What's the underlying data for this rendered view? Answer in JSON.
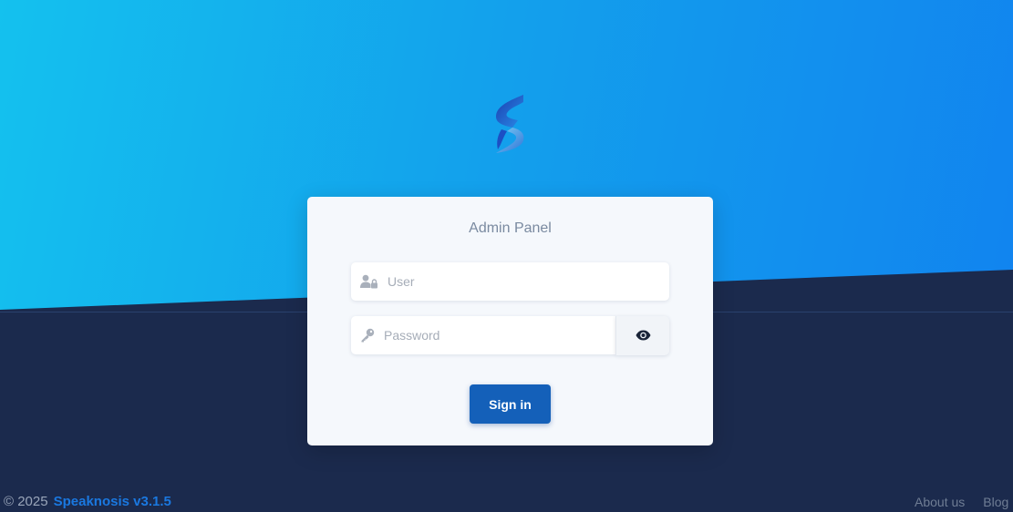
{
  "card": {
    "title": "Admin Panel",
    "user_placeholder": "User",
    "password_placeholder": "Password",
    "signin_label": "Sign in"
  },
  "icons": {
    "logo": "speaknosis-logo",
    "user": "user-lock-icon",
    "password": "key-icon",
    "toggle": "eye-icon"
  },
  "footer": {
    "copyright": "© 2025",
    "brand": "Speaknosis v3.1.5",
    "links": [
      "About us",
      "Blog"
    ]
  },
  "colors": {
    "primary": "#1460b9",
    "brand_text": "#1a78e0",
    "dark_bg": "#1b2a4d"
  }
}
